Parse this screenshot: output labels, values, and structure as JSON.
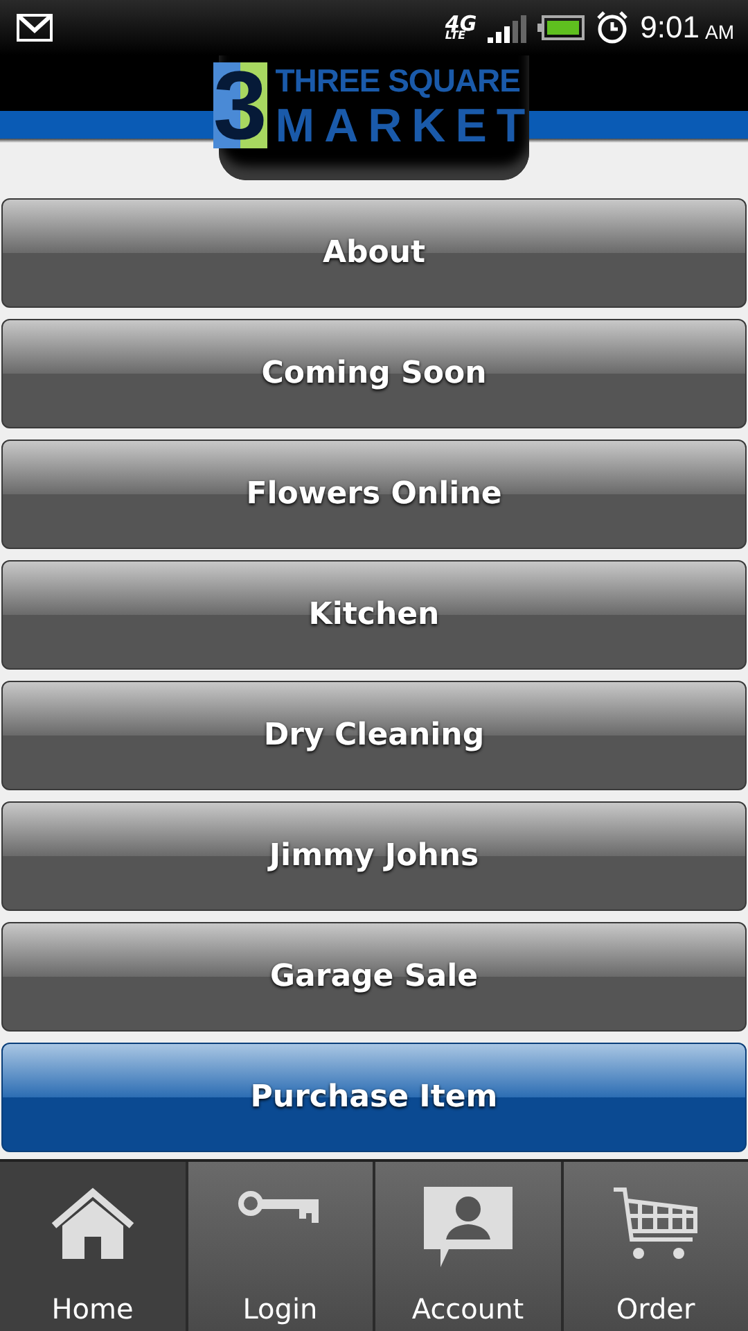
{
  "status_bar": {
    "network": "4G",
    "network_sub": "LTE",
    "time": "9:01",
    "ampm": "AM"
  },
  "logo": {
    "digit": "3",
    "line1": "THREE SQUARE",
    "line2": "MARKET"
  },
  "menu": [
    {
      "label": "About",
      "kind": "default"
    },
    {
      "label": "Coming Soon",
      "kind": "default"
    },
    {
      "label": "Flowers Online",
      "kind": "default"
    },
    {
      "label": "Kitchen",
      "kind": "default"
    },
    {
      "label": "Dry Cleaning",
      "kind": "default"
    },
    {
      "label": "Jimmy Johns",
      "kind": "default"
    },
    {
      "label": "Garage Sale",
      "kind": "default"
    },
    {
      "label": "Purchase Item",
      "kind": "primary"
    }
  ],
  "tabs": [
    {
      "label": "Home",
      "kind": "home",
      "selected": true
    },
    {
      "label": "Login",
      "kind": "key",
      "selected": false
    },
    {
      "label": "Account",
      "kind": "account",
      "selected": false
    },
    {
      "label": "Order",
      "kind": "cart",
      "selected": false
    }
  ]
}
